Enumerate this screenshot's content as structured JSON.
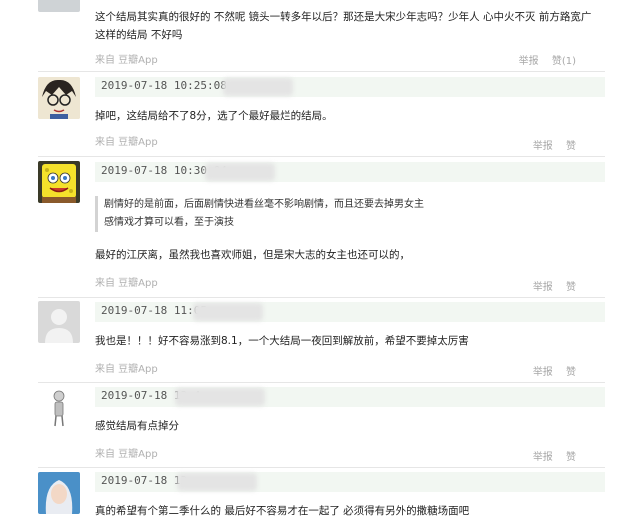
{
  "comments": [
    {
      "text": "这个结局其实真的很好的 不然呢 镜头一转多年以后？那还是大宋少年志吗？少年人 心中火不灭 前方路宽广 这样的结局 不好吗",
      "source": "来自 豆瓣App",
      "report": "举报",
      "like": "赞(1)"
    },
    {
      "time": "2019-07-18 10:25:08",
      "text": "掉吧，这结局给不了8分，选了个最好最烂的结局。",
      "source": "来自 豆瓣App",
      "report": "举报",
      "like": "赞"
    },
    {
      "time": "2019-07-18 10:30:04",
      "quote": "剧情好的是前面，后面剧情快进看丝毫不影响剧情，而且还要去掉男女主感情戏才算可以看，至于演技",
      "text": "最好的江厌离，虽然我也喜欢师姐，但是宋大志的女主也还可以的，",
      "source": "来自 豆瓣App",
      "report": "举报",
      "like": "赞"
    },
    {
      "time": "2019-07-18 11:05",
      "text": "我也是！！！好不容易涨到8.1，一个大结局一夜回到解放前，希望不要掉太厉害",
      "source": "来自 豆瓣App",
      "report": "举报",
      "like": "赞"
    },
    {
      "time": "2019-07-18 13:4",
      "text": "感觉结局有点掉分",
      "source": "来自 豆瓣App",
      "report": "举报",
      "like": "赞"
    },
    {
      "time": "2019-07-18 13",
      "text": "真的希望有个第二季什么的 最后好不容易才在一起了 必须得有另外的撒糖场面吧"
    }
  ]
}
